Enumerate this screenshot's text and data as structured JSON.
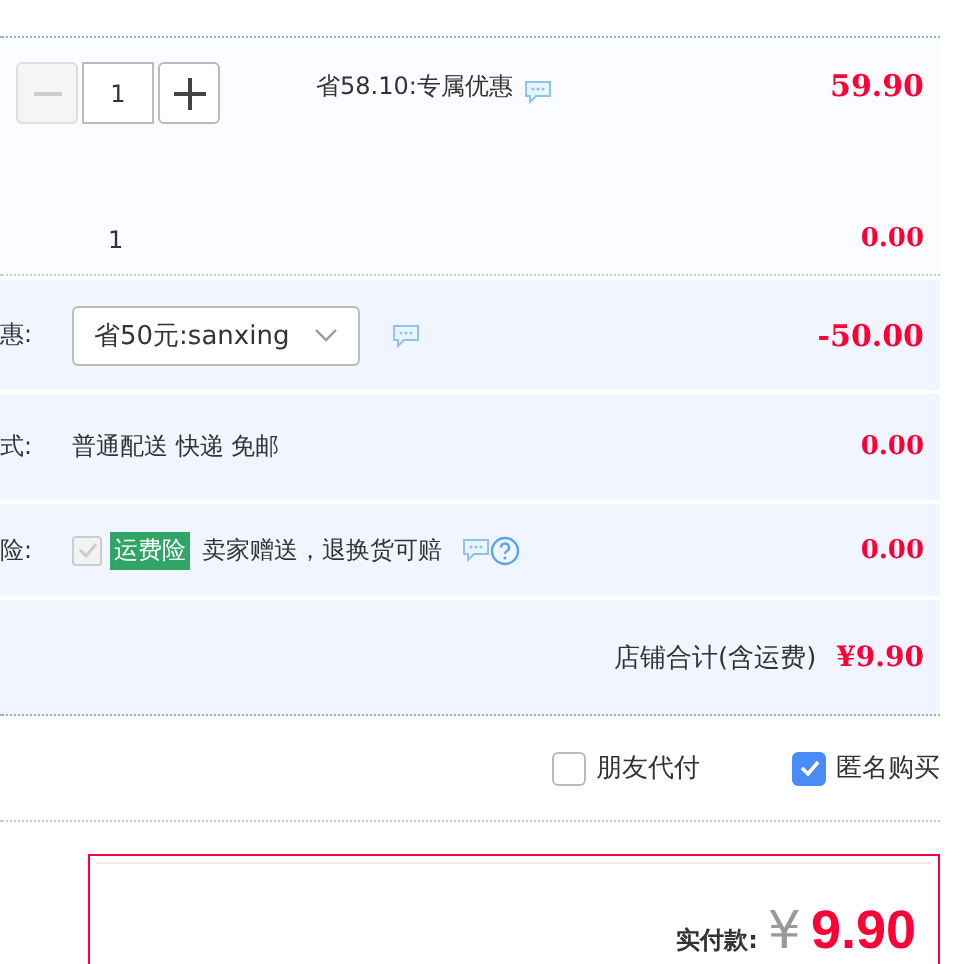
{
  "item": {
    "quantity": "1",
    "promo": "省58.10:专属优惠",
    "price": "59.90",
    "count": "1",
    "subtotal": "0.00",
    "minus_disabled": true
  },
  "coupon": {
    "label": "惠:",
    "value": "省50元:sanxing",
    "amount": "-50.00"
  },
  "delivery": {
    "label": "式:",
    "value": "普通配送 快递 免邮",
    "amount": "0.00"
  },
  "insurance": {
    "label": "险:",
    "checked": true,
    "disabled": true,
    "tag": "运费险",
    "text": "卖家赠送，退换货可赔",
    "amount": "0.00"
  },
  "shop_total": {
    "label": "店铺合计(含运费)",
    "amount": "¥9.90"
  },
  "options": [
    {
      "label": "朋友代付",
      "checked": false
    },
    {
      "label": "匿名购买",
      "checked": true
    }
  ],
  "payment": {
    "label": "实付款:",
    "currency": "¥",
    "amount": "9.90"
  }
}
